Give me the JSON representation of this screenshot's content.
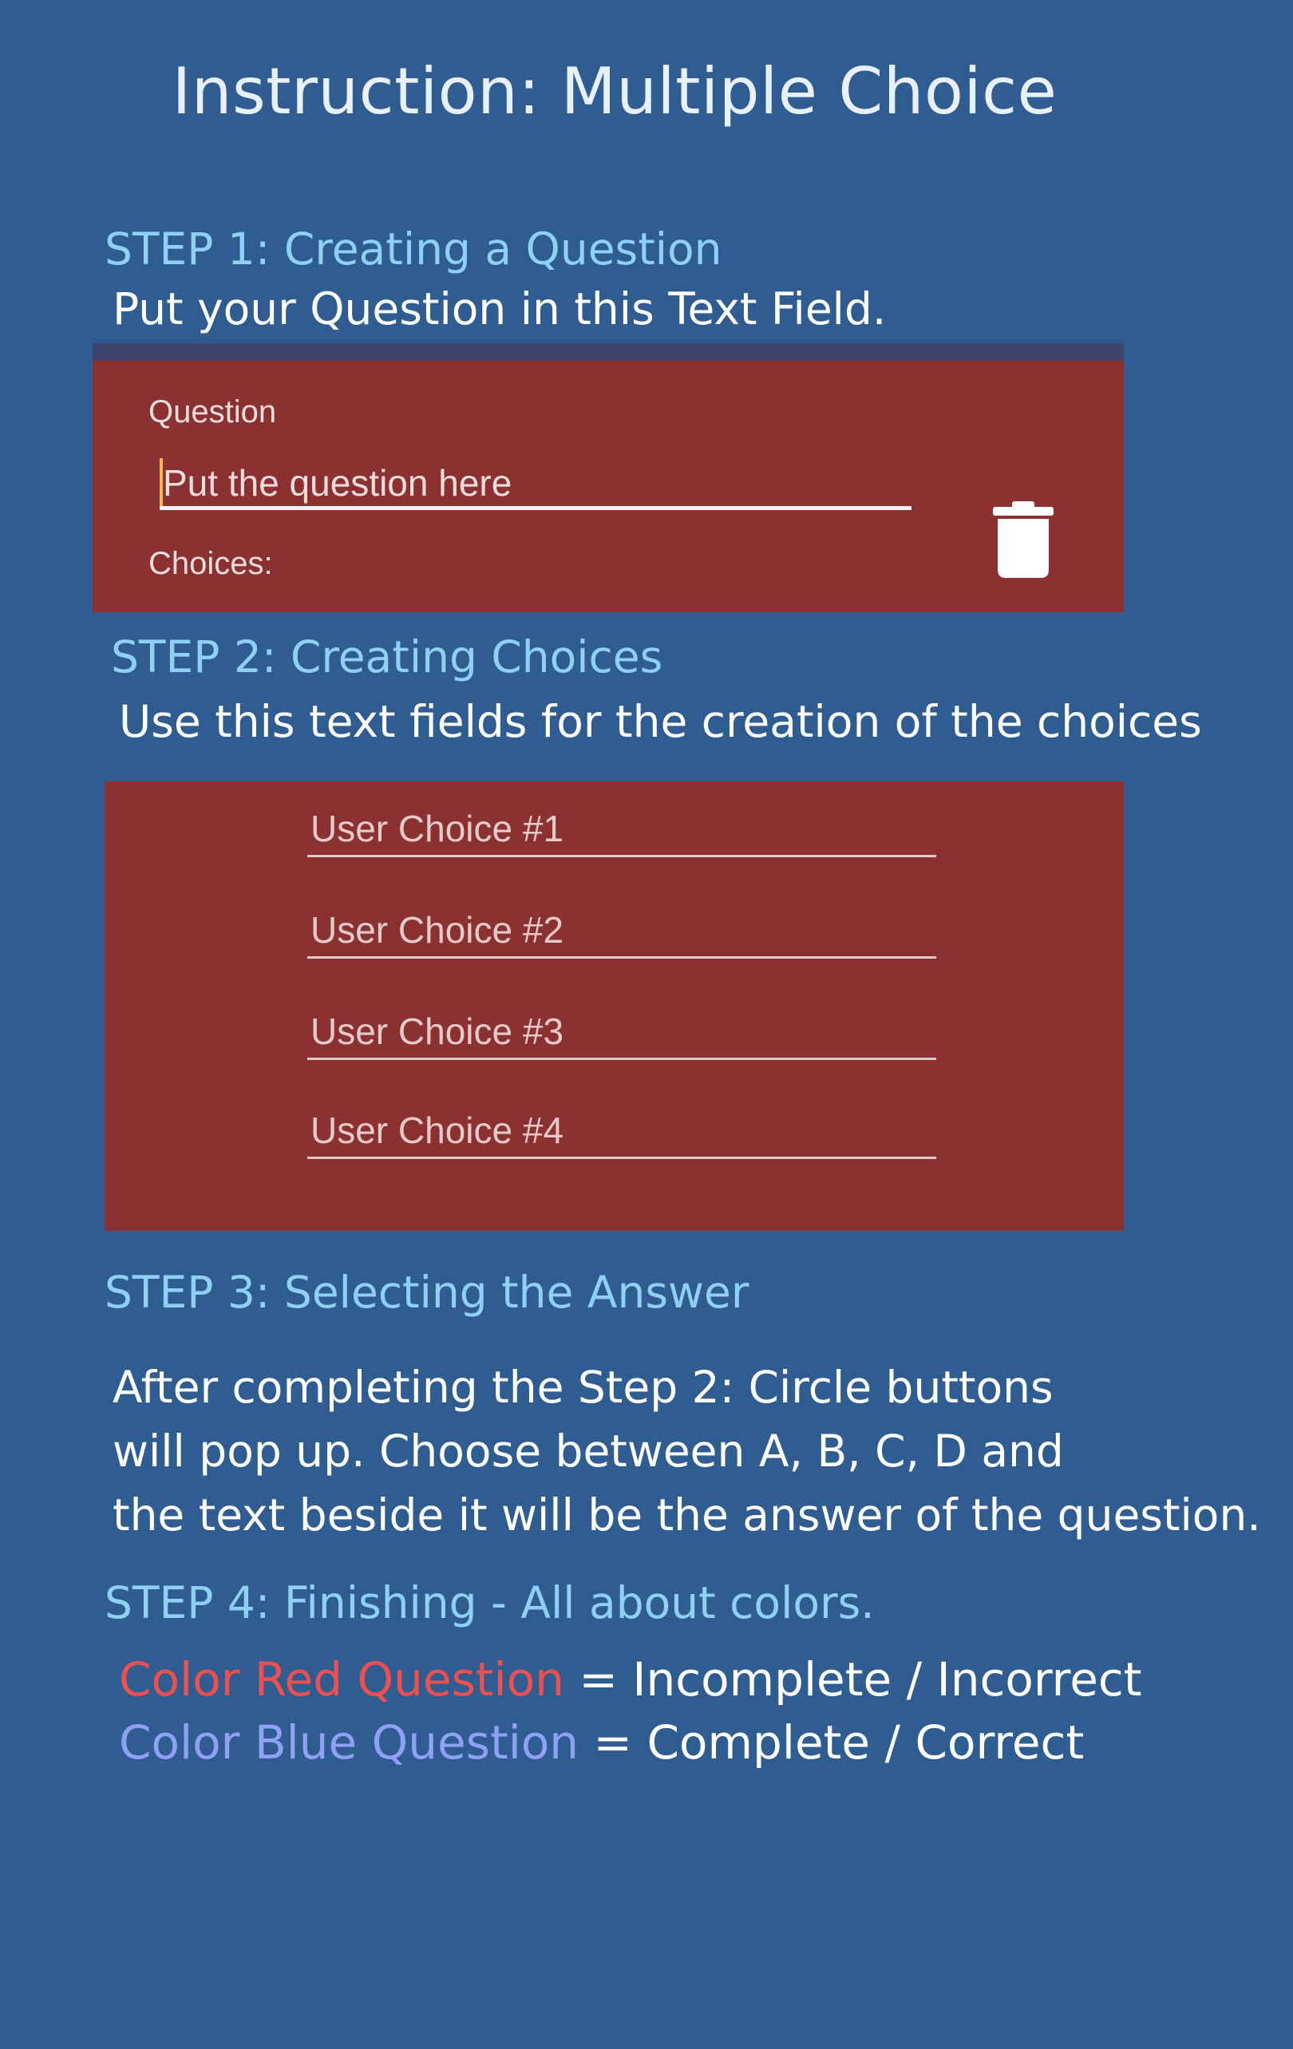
{
  "title": "Instruction: Multiple Choice",
  "step1": {
    "heading": "STEP 1: Creating a Question",
    "text": "Put your Question in this Text Field.",
    "question_label": "Question",
    "question_placeholder": "Put the question here",
    "choices_label": "Choices:"
  },
  "step2": {
    "heading": "STEP 2: Creating Choices",
    "text": "Use this text fields for the creation of the choices",
    "choices": [
      {
        "placeholder": "User Choice #1"
      },
      {
        "placeholder": "User Choice #2"
      },
      {
        "placeholder": "User Choice #3"
      },
      {
        "placeholder": "User Choice #4"
      }
    ]
  },
  "step3": {
    "heading": "STEP 3: Selecting the Answer",
    "lines": [
      "After completing the Step 2: Circle buttons",
      "will pop up. Choose between A, B, C, D and",
      "the text beside it will be the answer of the question."
    ]
  },
  "step4": {
    "heading": "STEP 4: Finishing - All about colors.",
    "red_label": "Color Red Question",
    "red_meaning": " = Incomplete / Incorrect",
    "blue_label": "Color Blue Question",
    "blue_meaning": " = Complete / Correct"
  },
  "colors": {
    "background": "#305d91",
    "panel": "#8c3131",
    "heading": "#8fd0f5",
    "red_text": "#ef4f4f",
    "blue_text": "#8fa0f5"
  },
  "icons": {
    "delete": "trash-icon"
  }
}
